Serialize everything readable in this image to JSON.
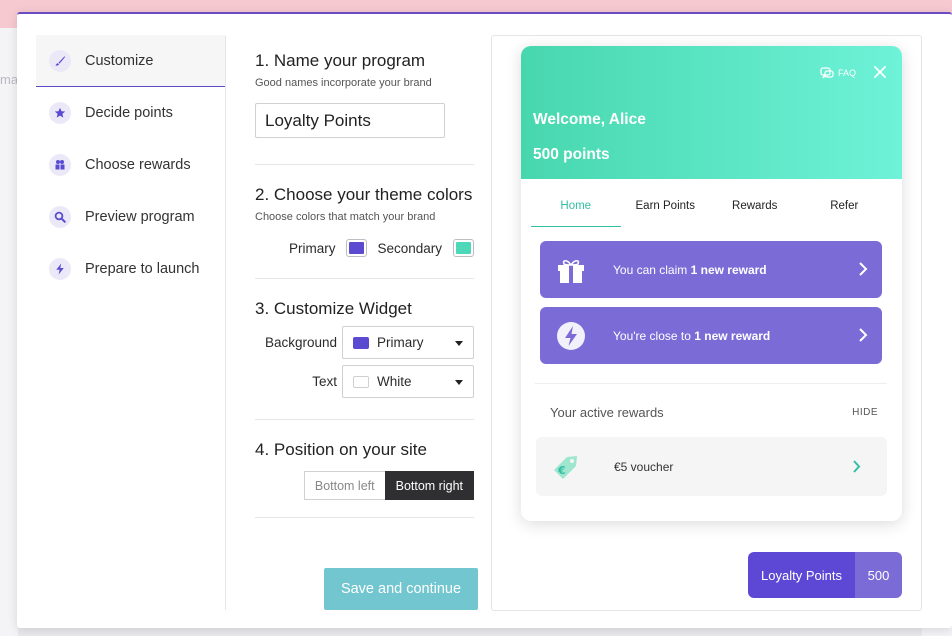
{
  "backdrop": {
    "fragment_text": "ma"
  },
  "sidebar": {
    "items": [
      {
        "label": "Customize",
        "icon": "brush-icon",
        "active": true
      },
      {
        "label": "Decide points",
        "icon": "star-icon"
      },
      {
        "label": "Choose rewards",
        "icon": "gift-icon"
      },
      {
        "label": "Preview program",
        "icon": "magnifier-icon"
      },
      {
        "label": "Prepare to launch",
        "icon": "bolt-icon"
      }
    ]
  },
  "form": {
    "step1": {
      "title": "1. Name your program",
      "hint": "Good names incorporate your brand",
      "value": "Loyalty Points"
    },
    "step2": {
      "title": "2. Choose your theme colors",
      "hint": "Choose colors that match your brand",
      "primary_label": "Primary",
      "secondary_label": "Secondary"
    },
    "step3": {
      "title": "3. Customize Widget",
      "background_label": "Background",
      "background_value": "Primary",
      "text_label": "Text",
      "text_value": "White"
    },
    "step4": {
      "title": "4. Position on your site",
      "left_label": "Bottom left",
      "right_label": "Bottom right",
      "selected": "Bottom right"
    },
    "save_label": "Save and continue"
  },
  "colors": {
    "primary": "#5a4bd1",
    "secondary": "#4ed8ba",
    "accent_teal": "#33bfa4",
    "card_purple": "#7b6bd6"
  },
  "widget": {
    "faq_label": "FAQ",
    "welcome": "Welcome, Alice",
    "points": "500 points",
    "tabs": [
      "Home",
      "Earn Points",
      "Rewards",
      "Refer"
    ],
    "active_tab": "Home",
    "card_claim": {
      "pre": "You can claim ",
      "bold": "1 new reward"
    },
    "card_close": {
      "pre": "You're close to ",
      "bold": "1 new reward"
    },
    "active_rewards_label": "Your active rewards",
    "hide_label": "HIDE",
    "voucher_label": "€5 voucher"
  },
  "launcher": {
    "name": "Loyalty Points",
    "points": "500"
  }
}
